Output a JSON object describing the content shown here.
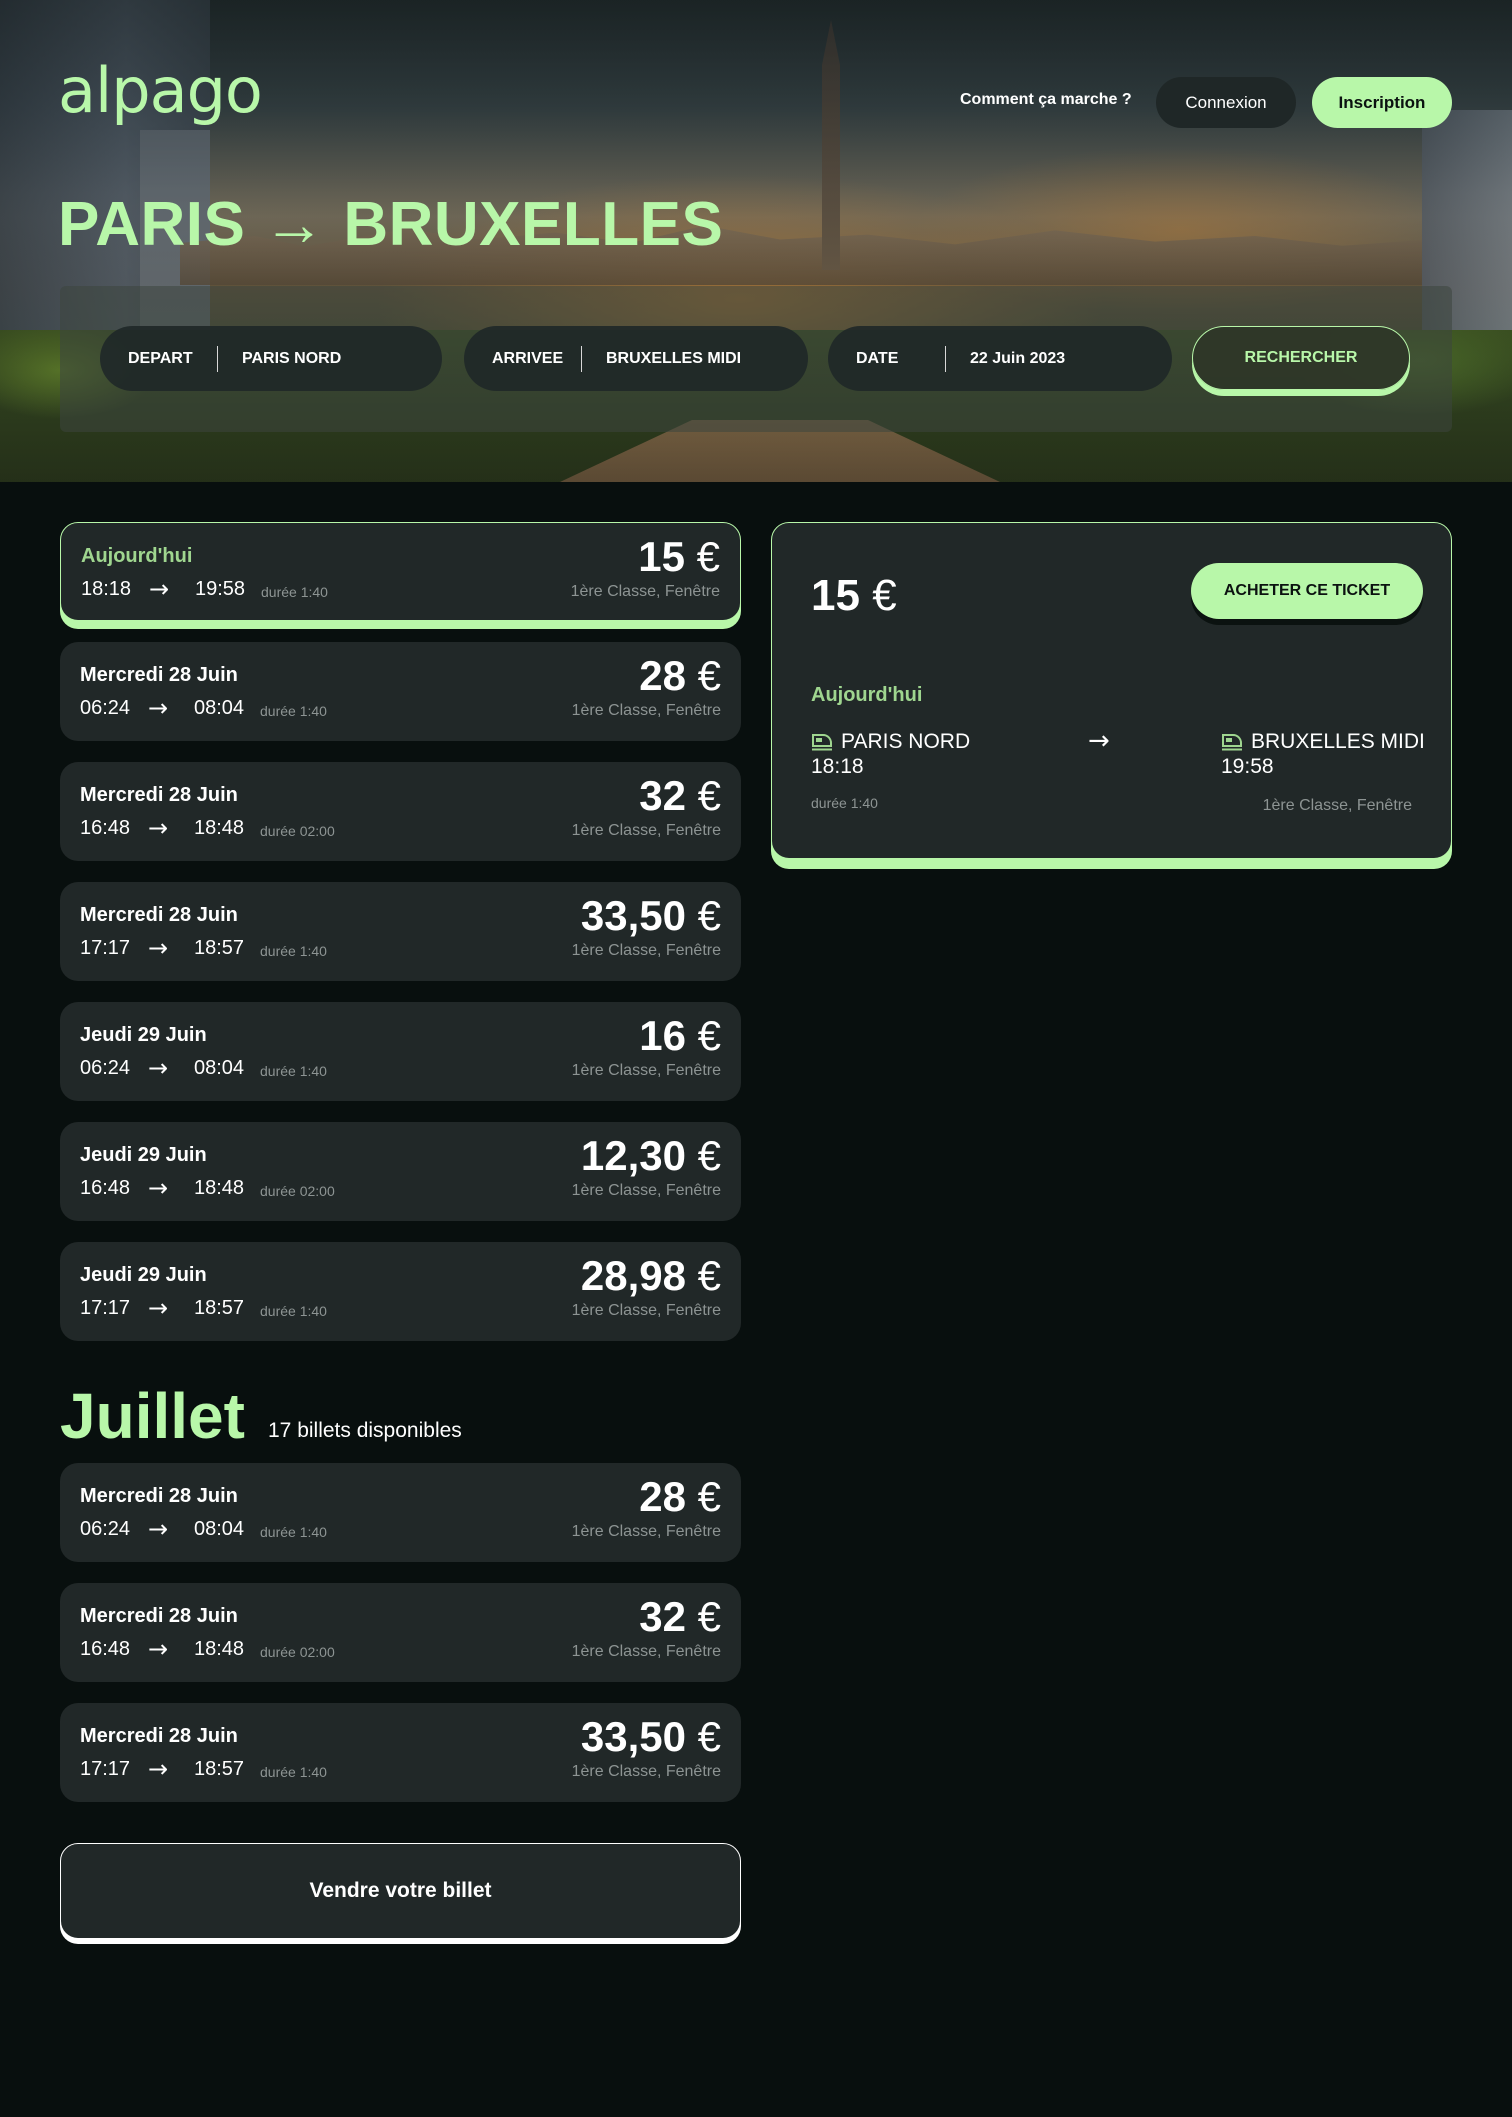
{
  "header": {
    "logo": "alpago",
    "how_it_works": "Comment ça marche ?",
    "login": "Connexion",
    "signup": "Inscription"
  },
  "hero": {
    "title": "PARIS → BRUXELLES"
  },
  "search": {
    "departure_label": "DEPART",
    "departure_value": "PARIS NORD",
    "arrival_label": "ARRIVEE",
    "arrival_value": "BRUXELLES MIDI",
    "date_label": "DATE",
    "date_value": "22 Juin 2023",
    "submit": "RECHERCHER"
  },
  "tickets": [
    {
      "day": "Aujourd'hui",
      "dep": "18:18",
      "arr": "19:58",
      "duration": "durée 1:40",
      "price": "15",
      "currency": "€",
      "class": "1ère Classe, Fenêtre",
      "selected": true
    },
    {
      "day": "Mercredi 28 Juin",
      "dep": "06:24",
      "arr": "08:04",
      "duration": "durée 1:40",
      "price": "28",
      "currency": "€",
      "class": "1ère Classe, Fenêtre"
    },
    {
      "day": "Mercredi 28 Juin",
      "dep": "16:48",
      "arr": "18:48",
      "duration": "durée 02:00",
      "price": "32",
      "currency": "€",
      "class": "1ère Classe, Fenêtre"
    },
    {
      "day": "Mercredi 28 Juin",
      "dep": "17:17",
      "arr": "18:57",
      "duration": "durée 1:40",
      "price": "33,50",
      "currency": "€",
      "class": "1ère Classe, Fenêtre"
    },
    {
      "day": "Jeudi 29 Juin",
      "dep": "06:24",
      "arr": "08:04",
      "duration": "durée 1:40",
      "price": "16",
      "currency": "€",
      "class": "1ère Classe, Fenêtre"
    },
    {
      "day": "Jeudi 29 Juin",
      "dep": "16:48",
      "arr": "18:48",
      "duration": "durée 02:00",
      "price": "12,30",
      "currency": "€",
      "class": "1ère Classe, Fenêtre"
    },
    {
      "day": "Jeudi 29 Juin",
      "dep": "17:17",
      "arr": "18:57",
      "duration": "durée 1:40",
      "price": "28,98",
      "currency": "€",
      "class": "1ère Classe, Fenêtre"
    }
  ],
  "july": {
    "title": "Juillet",
    "count": "17 billets disponibles",
    "tickets": [
      {
        "day": "Mercredi 28 Juin",
        "dep": "06:24",
        "arr": "08:04",
        "duration": "durée 1:40",
        "price": "28",
        "currency": "€",
        "class": "1ère Classe, Fenêtre"
      },
      {
        "day": "Mercredi 28 Juin",
        "dep": "16:48",
        "arr": "18:48",
        "duration": "durée 02:00",
        "price": "32",
        "currency": "€",
        "class": "1ère Classe, Fenêtre"
      },
      {
        "day": "Mercredi 28 Juin",
        "dep": "17:17",
        "arr": "18:57",
        "duration": "durée 1:40",
        "price": "33,50",
        "currency": "€",
        "class": "1ère Classe, Fenêtre"
      }
    ]
  },
  "sell_button": "Vendre votre billet",
  "detail": {
    "price": "15",
    "currency": "€",
    "buy": "ACHETER CE TICKET",
    "day": "Aujourd'hui",
    "from_station": "PARIS NORD",
    "from_time": "18:18",
    "to_station": "BRUXELLES MIDI",
    "to_time": "19:58",
    "duration": "durée 1:40",
    "class": "1ère Classe, Fenêtre"
  },
  "icons": {
    "arrow": "→",
    "train": "train-icon"
  },
  "colors": {
    "accent": "#b8f7a9",
    "accent_text": "#9fd68f",
    "background": "#080f0e",
    "card": "#212828",
    "muted": "#8d9493"
  }
}
